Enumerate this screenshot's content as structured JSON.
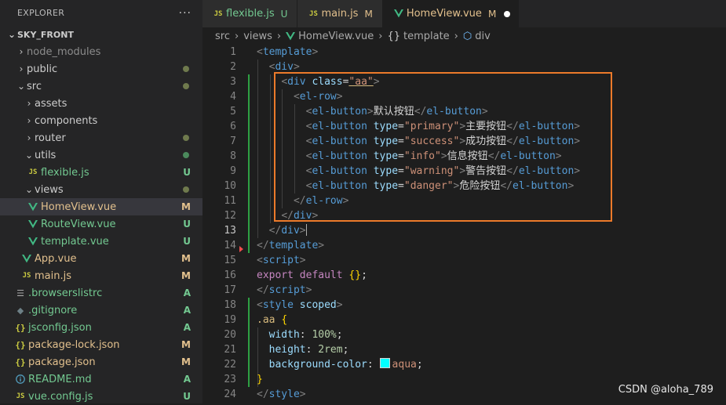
{
  "explorer": {
    "title": "EXPLORER",
    "more": "···",
    "project": "SKY_FRONT",
    "items": [
      {
        "label": "node_modules",
        "status": ""
      },
      {
        "label": "public",
        "status": ""
      },
      {
        "label": "src",
        "status": ""
      },
      {
        "label": "assets",
        "status": ""
      },
      {
        "label": "components",
        "status": ""
      },
      {
        "label": "router",
        "status": ""
      },
      {
        "label": "utils",
        "status": ""
      },
      {
        "label": "flexible.js",
        "status": "U"
      },
      {
        "label": "views",
        "status": ""
      },
      {
        "label": "HomeView.vue",
        "status": "M"
      },
      {
        "label": "RouteView.vue",
        "status": "U"
      },
      {
        "label": "template.vue",
        "status": "U"
      },
      {
        "label": "App.vue",
        "status": "M"
      },
      {
        "label": "main.js",
        "status": "M"
      },
      {
        "label": ".browserslistrc",
        "status": "A"
      },
      {
        "label": ".gitignore",
        "status": "A"
      },
      {
        "label": "jsconfig.json",
        "status": "A"
      },
      {
        "label": "package-lock.json",
        "status": "M"
      },
      {
        "label": "package.json",
        "status": "M"
      },
      {
        "label": "README.md",
        "status": "A"
      },
      {
        "label": "vue.config.js",
        "status": "U"
      }
    ]
  },
  "tabs": [
    {
      "icon": "JS",
      "label": "flexible.js",
      "status": "U"
    },
    {
      "icon": "JS",
      "label": "main.js",
      "status": "M"
    },
    {
      "icon": "vue",
      "label": "HomeView.vue",
      "status": "M"
    }
  ],
  "breadcrumb": {
    "src": "src",
    "views": "views",
    "file": "HomeView.vue",
    "template": "template",
    "div": "div"
  },
  "editor": {
    "line_numbers": [
      "1",
      "2",
      "3",
      "4",
      "5",
      "6",
      "7",
      "8",
      "9",
      "10",
      "11",
      "12",
      "13",
      "14",
      "15",
      "16",
      "17",
      "18",
      "19",
      "20",
      "21",
      "22",
      "23",
      "24"
    ],
    "current_line": "13",
    "lines": {
      "l1": {
        "t1": "<",
        "n1": "template",
        "t2": ">"
      },
      "l2": {
        "t1": "<",
        "n1": "div",
        "t2": ">"
      },
      "l3": {
        "t1": "<",
        "n1": "div",
        "a1": "class",
        "eq": "=",
        "s1": "\"aa\"",
        "t2": ">"
      },
      "l4": {
        "t1": "<",
        "n1": "el-row",
        "t2": ">"
      },
      "l5": {
        "t1": "<",
        "n1": "el-button",
        "t2": ">",
        "text": "默认按钮",
        "t3": "</",
        "n2": "el-button",
        "t4": ">"
      },
      "l6": {
        "t1": "<",
        "n1": "el-button",
        "a1": "type",
        "eq": "=",
        "s1": "\"primary\"",
        "t2": ">",
        "text": "主要按钮",
        "t3": "</",
        "n2": "el-button",
        "t4": ">"
      },
      "l7": {
        "t1": "<",
        "n1": "el-button",
        "a1": "type",
        "eq": "=",
        "s1": "\"success\"",
        "t2": ">",
        "text": "成功按钮",
        "t3": "</",
        "n2": "el-button",
        "t4": ">"
      },
      "l8": {
        "t1": "<",
        "n1": "el-button",
        "a1": "type",
        "eq": "=",
        "s1": "\"info\"",
        "t2": ">",
        "text": "信息按钮",
        "t3": "</",
        "n2": "el-button",
        "t4": ">"
      },
      "l9": {
        "t1": "<",
        "n1": "el-button",
        "a1": "type",
        "eq": "=",
        "s1": "\"warning\"",
        "t2": ">",
        "text": "警告按钮",
        "t3": "</",
        "n2": "el-button",
        "t4": ">"
      },
      "l10": {
        "t1": "<",
        "n1": "el-button",
        "a1": "type",
        "eq": "=",
        "s1": "\"danger\"",
        "t2": ">",
        "text": "危险按钮",
        "t3": "</",
        "n2": "el-button",
        "t4": ">"
      },
      "l11": {
        "t1": "</",
        "n1": "el-row",
        "t2": ">"
      },
      "l12": {
        "t1": "</",
        "n1": "div",
        "t2": ">"
      },
      "l13": {
        "t1": "</",
        "n1": "div",
        "t2": ">"
      },
      "l14": {
        "t1": "</",
        "n1": "template",
        "t2": ">"
      },
      "l15": {
        "t1": "<",
        "n1": "script",
        "t2": ">"
      },
      "l16": {
        "k1": "export",
        "k2": "default",
        "b1": "{}",
        "p1": ";"
      },
      "l17": {
        "t1": "</",
        "n1": "script",
        "t2": ">"
      },
      "l18": {
        "t1": "<",
        "n1": "style",
        "a1": "scoped",
        "t2": ">"
      },
      "l19": {
        "sel": ".aa",
        "b1": "{"
      },
      "l20": {
        "prop": "width",
        "colon": ": ",
        "val": "100%",
        "semi": ";"
      },
      "l21": {
        "prop": "height",
        "colon": ": ",
        "val": "2rem",
        "semi": ";"
      },
      "l22": {
        "prop": "background-color",
        "colon": ": ",
        "val": "aqua",
        "semi": ";"
      },
      "l23": {
        "b1": "}"
      },
      "l24": {
        "t1": "</",
        "n1": "style",
        "t2": ">"
      }
    }
  },
  "watermark": "CSDN @aloha_789",
  "colors": {
    "accent_box": "#ec7a2a",
    "modified": "#e2c08d",
    "untracked": "#73c991",
    "swatch": "#00ffff"
  }
}
